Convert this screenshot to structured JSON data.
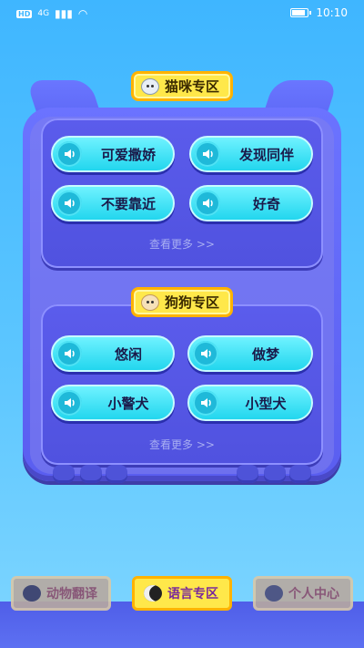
{
  "status_bar": {
    "network_badge": "HD",
    "signal_text": "4G",
    "time": "10:10"
  },
  "cat_section": {
    "title": "猫咪专区",
    "icon": "cat-face-icon",
    "buttons": [
      "可爱撒娇",
      "发现同伴",
      "不要靠近",
      "好奇"
    ],
    "more": "查看更多 >>"
  },
  "dog_section": {
    "title": "狗狗专区",
    "icon": "dog-face-icon",
    "buttons": [
      "悠闲",
      "做梦",
      "小警犬",
      "小型犬"
    ],
    "more": "查看更多 >>"
  },
  "nav": {
    "items": [
      {
        "label": "动物翻译",
        "icon": "cat-icon",
        "active": false
      },
      {
        "label": "语言专区",
        "icon": "cat-icon",
        "active": true
      },
      {
        "label": "个人中心",
        "icon": "cat-icon",
        "active": false
      }
    ]
  },
  "colors": {
    "background": "#3fb6ff",
    "board": "#5a5ef0",
    "pill": "#22d6ee",
    "highlight": "#ffe84a"
  }
}
